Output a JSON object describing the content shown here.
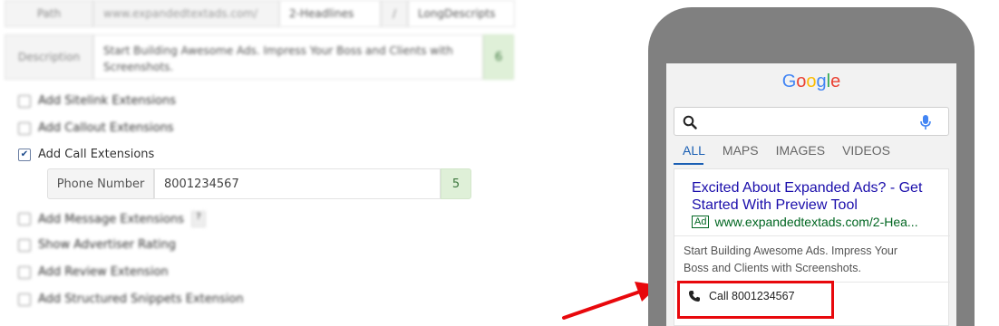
{
  "form": {
    "path_label": "Path",
    "path_domain": "www.expandedtextads.com/",
    "path1": "2-Headlines",
    "path_sep": "/",
    "path2": "LongDescripts",
    "description_label": "Description",
    "description_value": "Start Building Awesome Ads. Impress Your Boss and Clients with Screenshots.",
    "description_count": "6",
    "extensions_top": [
      "Add Sitelink Extensions",
      "Add Callout Extensions"
    ],
    "call_extension_label": "Add Call Extensions",
    "phone_label": "Phone Number",
    "phone_value": "8001234567",
    "phone_count": "5",
    "extensions_bottom": [
      "Add Message Extensions",
      "Show Advertiser Rating",
      "Add Review Extension",
      "Add Structured Snippets Extension"
    ],
    "message_help": "?"
  },
  "preview": {
    "logo_letters": [
      {
        "ch": "G",
        "color": "#4285f4"
      },
      {
        "ch": "o",
        "color": "#ea4335"
      },
      {
        "ch": "o",
        "color": "#fbbc05"
      },
      {
        "ch": "g",
        "color": "#4285f4"
      },
      {
        "ch": "l",
        "color": "#34a853"
      },
      {
        "ch": "e",
        "color": "#ea4335"
      }
    ],
    "tabs": [
      "ALL",
      "MAPS",
      "IMAGES",
      "VIDEOS"
    ],
    "active_tab": "ALL",
    "ad": {
      "headline_line1": "Excited About Expanded Ads? - Get",
      "headline_line2": "Started With Preview Tool",
      "badge": "Ad",
      "display_url": "www.expandedtextads.com/2-Hea...",
      "description_line1": "Start Building Awesome Ads. Impress Your",
      "description_line2": "Boss and Clients with Screenshots.",
      "call_text": "Call 8001234567"
    }
  },
  "colors": {
    "phone_body": "#808080",
    "ad_link": "#1a0dab",
    "display_url": "#006621",
    "highlight": "#e8080c",
    "count_bg": "#dff0d8",
    "tab_active": "#1a5fb4"
  }
}
